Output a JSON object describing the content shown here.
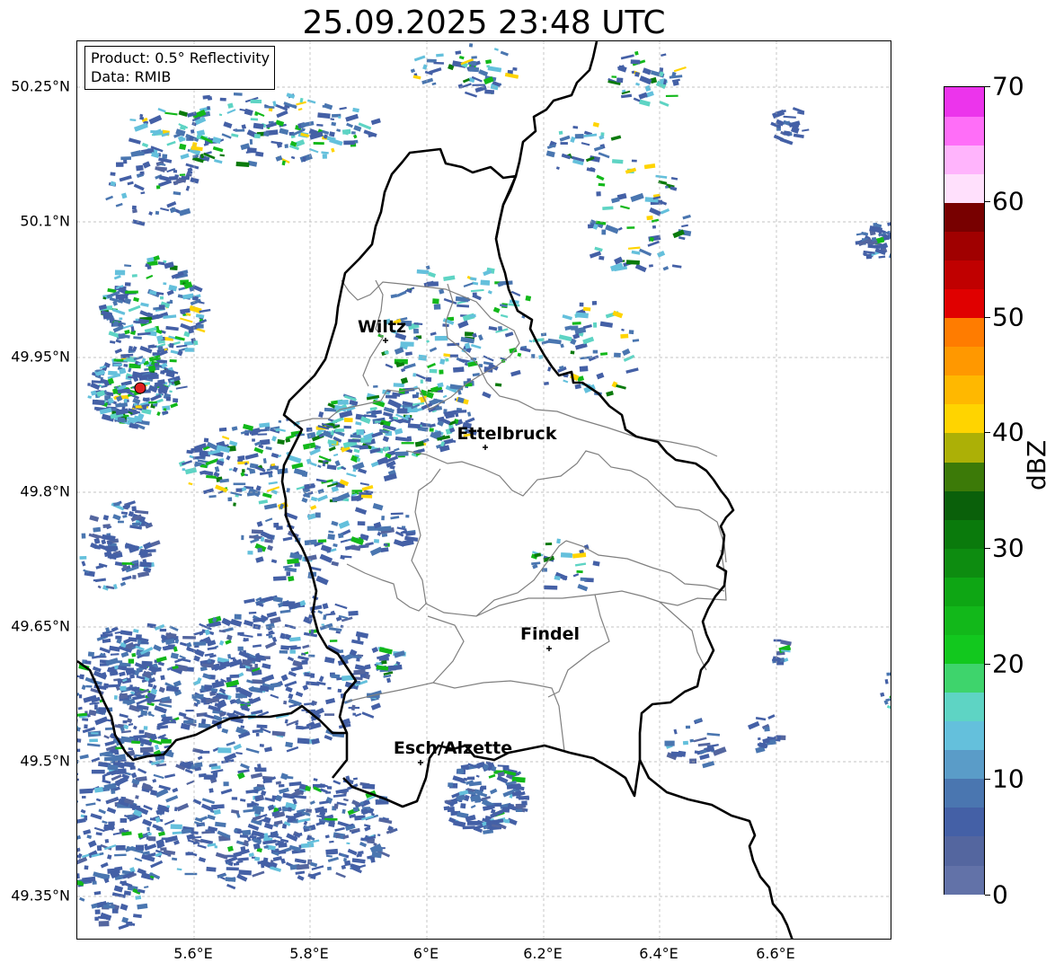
{
  "title": "25.09.2025 23:48 UTC",
  "info": {
    "product": "Product: 0.5° Reflectivity",
    "data_source": "Data: RMIB"
  },
  "axes": {
    "lat_ticks": [
      "50.25°N",
      "50.1°N",
      "49.95°N",
      "49.8°N",
      "49.65°N",
      "49.5°N",
      "49.35°N"
    ],
    "lon_ticks": [
      "5.6°E",
      "5.8°E",
      "6°E",
      "6.2°E",
      "6.4°E",
      "6.6°E"
    ]
  },
  "cities": [
    {
      "name": "Wiltz",
      "lon": 5.93,
      "lat": 49.965
    },
    {
      "name": "Ettelbruck",
      "lon": 6.1,
      "lat": 49.85
    },
    {
      "name": "Findel",
      "lon": 6.21,
      "lat": 49.625
    },
    {
      "name": "Esch/Alzette",
      "lon": 5.99,
      "lat": 49.5
    }
  ],
  "radar_site": {
    "lon": 5.505,
    "lat": 49.915,
    "color": "#e02020"
  },
  "colorbar": {
    "label": "dBZ",
    "min": 0,
    "max": 70,
    "ticks": [
      "0",
      "10",
      "20",
      "30",
      "40",
      "50",
      "60",
      "70"
    ],
    "colors": [
      "#6272a8",
      "#54669f",
      "#4460a6",
      "#4a76b0",
      "#5a9cc8",
      "#64c0dc",
      "#5ed4c4",
      "#3ed46c",
      "#12c81e",
      "#12b81a",
      "#0ea614",
      "#0d8c10",
      "#0a7a0c",
      "#0a600a",
      "#3c7a08",
      "#acb006",
      "#ffd400",
      "#ffb800",
      "#ff9800",
      "#ff7c00",
      "#e00000",
      "#c00000",
      "#a00000",
      "#780000",
      "#ffe0fc",
      "#ffb4fc",
      "#ff6ef8",
      "#ec34ec"
    ]
  },
  "map_colors": {
    "border": "#000000",
    "districts": "#7f7f7f",
    "grid": "#b0b0b0"
  }
}
